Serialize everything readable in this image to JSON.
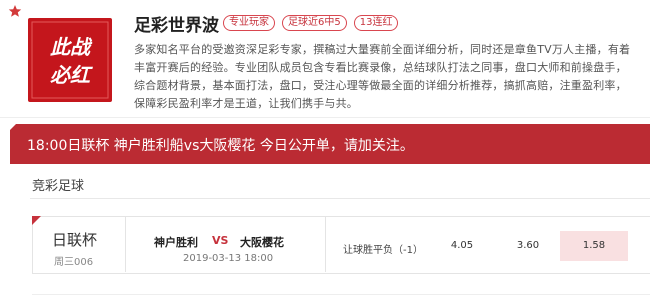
{
  "profile": {
    "avatar_text_line1": "此战",
    "avatar_text_line2": "必红",
    "name": "足彩世界波",
    "tags": [
      "专业玩家",
      "足球近6中5",
      "13连红"
    ],
    "description": "多家知名平台的受邀资深足彩专家，撰稿过大量赛前全面详细分析，同时还是章鱼TV万人主播，有着丰富开赛后的经验。专业团队成员包含专看比赛录像，总结球队打法之同事，盘口大师和前操盘手，综合题材背景，基本面打法，盘口，受注心理等做最全面的详细分析推荐，搞抓高赔，注重盈利率，保障彩民盈利率才是王道，让我们携手与共。"
  },
  "announcement": "18:00日联杯 神户胜利船vs大阪樱花 今日公开单，请加关注。",
  "section_title": "竞彩足球",
  "match": {
    "league": "日联杯",
    "match_no": "周三006",
    "home": "神户胜利",
    "vs": "VS",
    "away": "大阪樱花",
    "time": "2019-03-13 18:00",
    "bet_type": "让球胜平负（-1）",
    "odds": [
      "4.05",
      "3.60",
      "1.58"
    ],
    "selected_odd_index": 2
  },
  "colors": {
    "brand_red": "#bb2b33",
    "tag_red": "#c6323c",
    "selected_bg": "#f9e0e1"
  }
}
